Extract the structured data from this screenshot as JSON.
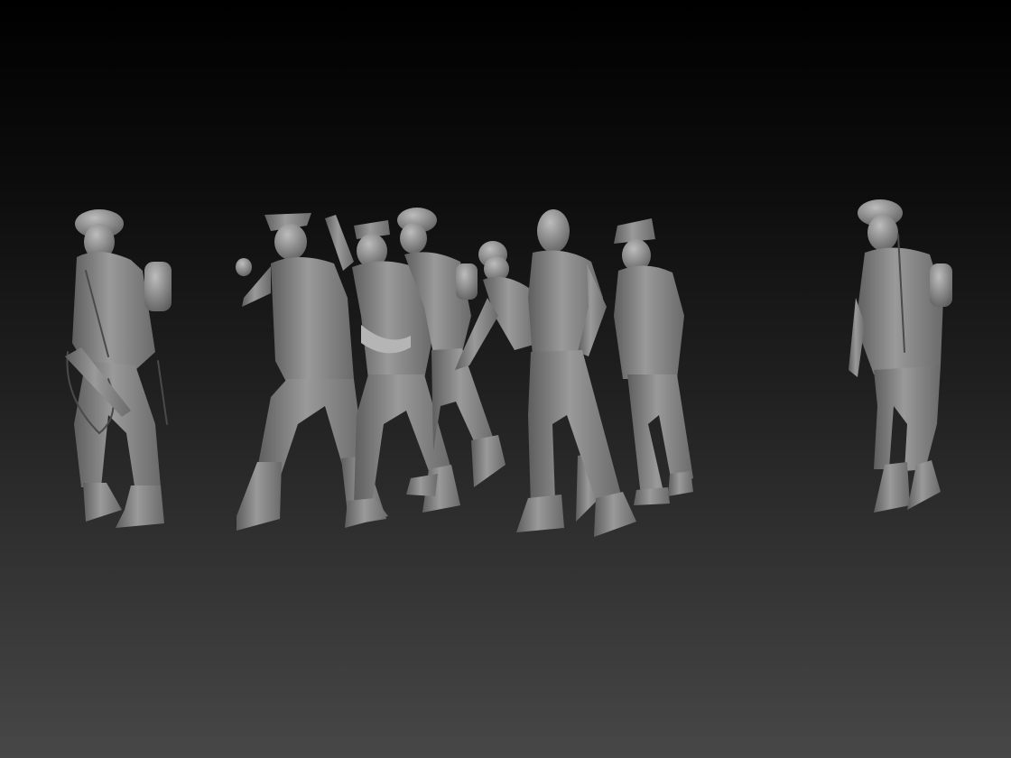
{
  "scene": {
    "colors": {
      "background_top": "#000000",
      "background_bottom": "#474747",
      "figure_clay": "#8c8c8c",
      "figure_highlight": "#c8c8c8",
      "figure_shadow": "#4a4a4a"
    },
    "figures": [
      {
        "id": "guard-left",
        "kind": "soldier",
        "headwear": "helmet",
        "carries": "rifle"
      },
      {
        "id": "prisoner-officer",
        "kind": "prisoner",
        "headwear": "peaked-cap"
      },
      {
        "id": "prisoner-hands-up",
        "kind": "prisoner",
        "headwear": "side-cap"
      },
      {
        "id": "prisoner-helmet",
        "kind": "prisoner",
        "headwear": "helmet"
      },
      {
        "id": "prisoner-wounded",
        "kind": "prisoner",
        "headwear": "side-cap"
      },
      {
        "id": "prisoner-shouting",
        "kind": "prisoner",
        "headwear": "none"
      },
      {
        "id": "prisoner-field-cap",
        "kind": "prisoner",
        "headwear": "field-cap"
      },
      {
        "id": "guard-right",
        "kind": "soldier",
        "headwear": "helmet",
        "carries": "rifle"
      }
    ]
  }
}
